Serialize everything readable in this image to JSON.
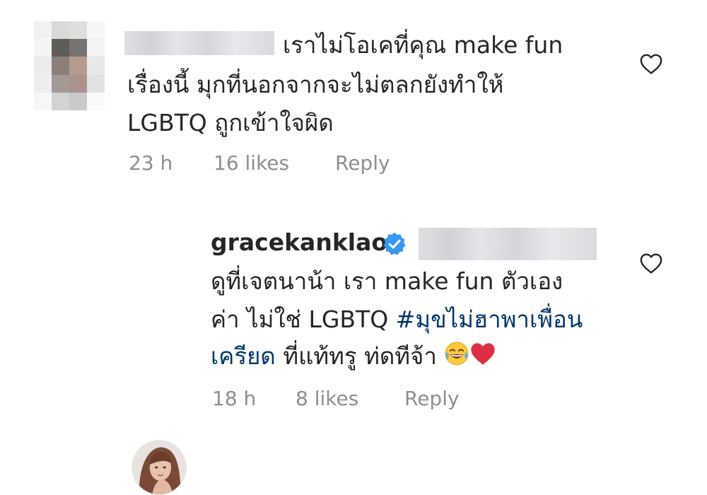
{
  "comments": [
    {
      "username_redacted": true,
      "lines": [
        "เราไม่โอเคที่คุณ make fun",
        "เรื่องนี้ มุกที่นอกจากจะไม่ตลกยังทำให้",
        "LGBTQ ถูกเข้าใจผิด"
      ],
      "time": "23 h",
      "likes": "16 likes",
      "reply": "Reply",
      "like_icon": "heart-outline-icon"
    },
    {
      "username": "gracekanklao",
      "verified": true,
      "mention_redacted": true,
      "line1": "ดูที่เจตนาน้า เรา make fun ตัวเอง",
      "line2_text": "ค่า ไม่ใช่ LGBTQ ",
      "line2_hashtag": "#มุขไม่ฮาพาเพื่อน",
      "line3_hashtag": "เครียด",
      "line3_text": " ที่แท้ทรู ท่ดทีจ้า ",
      "emojis": [
        "😂",
        "❤️"
      ],
      "time": "18 h",
      "likes": "8 likes",
      "reply": "Reply",
      "like_icon": "heart-outline-icon"
    }
  ],
  "colors": {
    "text": "#262626",
    "meta": "#8e8e8e",
    "hashtag": "#00376b",
    "verified": "#3897f0"
  }
}
